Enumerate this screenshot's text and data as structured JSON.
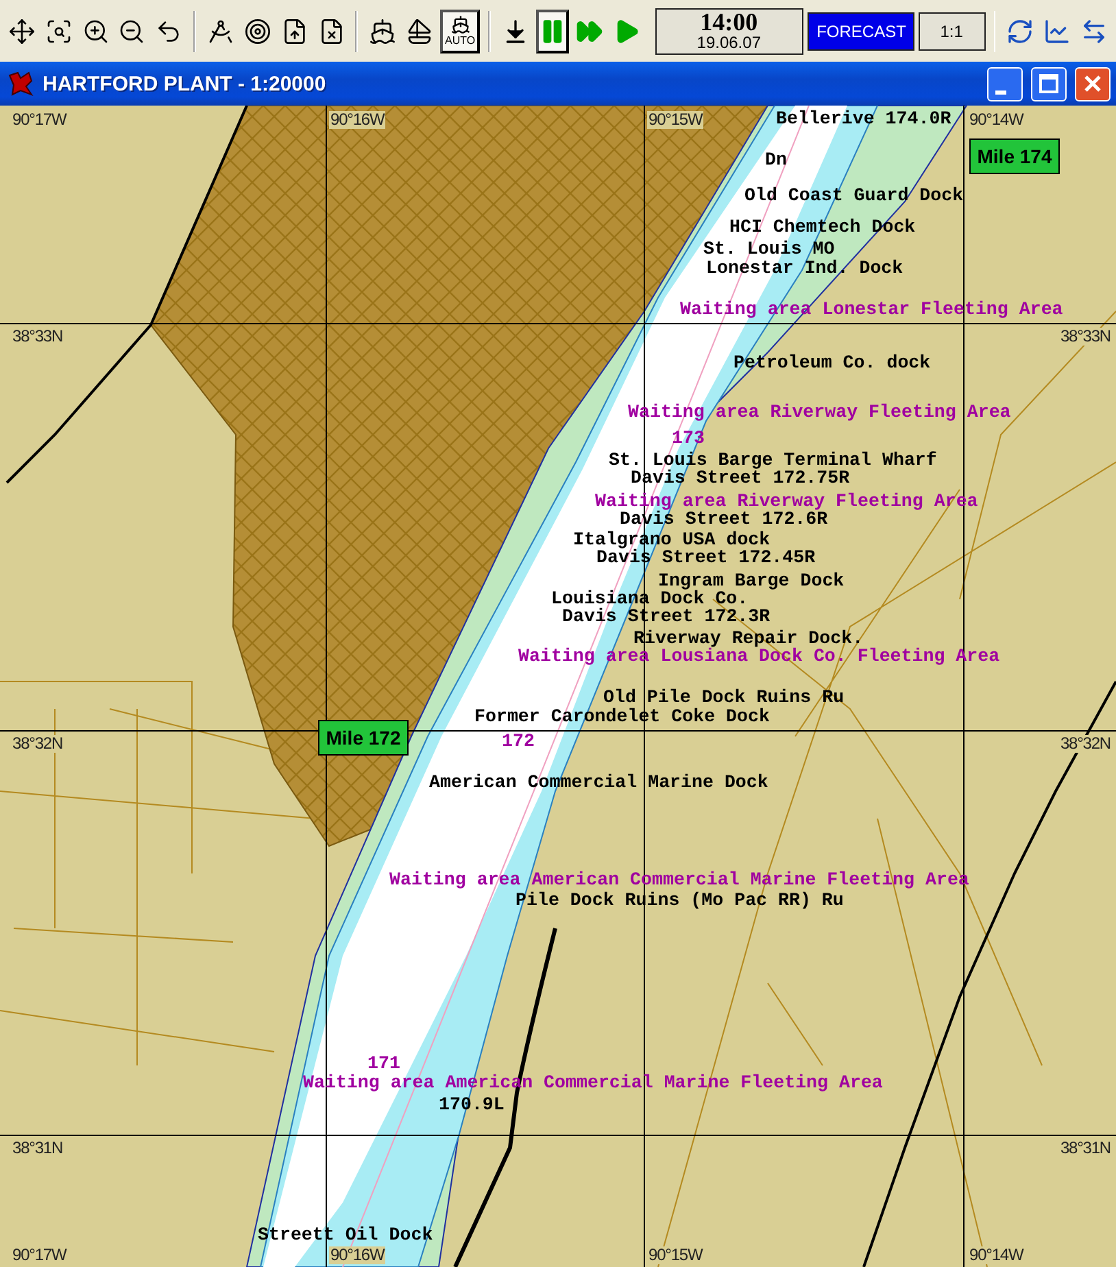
{
  "toolbar": {
    "tools": [
      {
        "pressed": false
      },
      {
        "pressed": false
      },
      {
        "pressed": false
      },
      {
        "pressed": false
      },
      {
        "pressed": false
      },
      {
        "pressed": false
      },
      {
        "pressed": false
      },
      {
        "pressed": false
      },
      {
        "pressed": false
      },
      {
        "pressed": false
      },
      {
        "pressed": false
      }
    ],
    "auto_button": {
      "label": "AUTO",
      "pressed": true
    },
    "playback": [
      {
        "pressed": false
      },
      {
        "pressed": true
      },
      {
        "pressed": false
      },
      {
        "pressed": false
      }
    ],
    "clock": {
      "time": "14:00",
      "date": "19.06.07"
    },
    "forecast_button": {
      "label": "FORECAST"
    },
    "scale": "1:1",
    "view_tools": [
      {
        "pressed": false
      },
      {
        "pressed": false
      },
      {
        "pressed": false
      }
    ]
  },
  "window": {
    "title": "HARTFORD PLANT - 1:20000"
  },
  "map": {
    "grid": {
      "top": [
        "90°17W",
        "90°16W",
        "90°15W",
        "90°14W"
      ],
      "bottom": [
        "90°17W",
        "90°16W",
        "90°15W",
        "90°14W"
      ],
      "left": [
        "38°33N",
        "38°32N",
        "38°31N"
      ],
      "right": [
        "38°33N",
        "38°32N",
        "38°31N"
      ]
    },
    "mile_markers": [
      "Mile 174",
      "Mile 172"
    ],
    "labels": [
      {
        "kind": "dock",
        "text": "Bellerive 174.0R"
      },
      {
        "kind": "dock",
        "text": "Dn"
      },
      {
        "kind": "dock",
        "text": "Old Coast Guard Dock"
      },
      {
        "kind": "dock",
        "text": "HCI Chemtech Dock"
      },
      {
        "kind": "dock",
        "text": "St. Louis MO"
      },
      {
        "kind": "dock",
        "text": "Lonestar Ind. Dock"
      },
      {
        "kind": "area",
        "text": "Waiting area Lonestar Fleeting Area"
      },
      {
        "kind": "dock",
        "text": "Petroleum Co. dock"
      },
      {
        "kind": "area",
        "text": "Waiting area Riverway Fleeting Area"
      },
      {
        "kind": "area",
        "text": "173"
      },
      {
        "kind": "dock",
        "text": "St. Louis Barge Terminal Wharf"
      },
      {
        "kind": "dock",
        "text": "Davis Street 172.75R"
      },
      {
        "kind": "area",
        "text": "Waiting area Riverway Fleeting Area"
      },
      {
        "kind": "dock",
        "text": "Davis Street 172.6R"
      },
      {
        "kind": "dock",
        "text": "Italgrano USA dock"
      },
      {
        "kind": "dock",
        "text": "Davis Street 172.45R"
      },
      {
        "kind": "dock",
        "text": "Ingram Barge Dock"
      },
      {
        "kind": "dock",
        "text": "Louisiana Dock Co."
      },
      {
        "kind": "dock",
        "text": "Davis Street 172.3R"
      },
      {
        "kind": "dock",
        "text": "Riverway Repair Dock."
      },
      {
        "kind": "area",
        "text": "Waiting area Lousiana Dock Co. Fleeting Area"
      },
      {
        "kind": "dock",
        "text": "Old Pile Dock Ruins Ru"
      },
      {
        "kind": "dock",
        "text": "Former Carondelet Coke Dock"
      },
      {
        "kind": "area",
        "text": "172"
      },
      {
        "kind": "dock",
        "text": "American Commercial Marine Dock"
      },
      {
        "kind": "area",
        "text": "Waiting area American Commercial Marine Fleeting Area"
      },
      {
        "kind": "dock",
        "text": "Pile Dock Ruins (Mo Pac RR) Ru"
      },
      {
        "kind": "area",
        "text": "171"
      },
      {
        "kind": "area",
        "text": "Waiting area American Commercial Marine Fleeting Area"
      },
      {
        "kind": "dock",
        "text": "170.9L"
      },
      {
        "kind": "dock",
        "text": "Streett Oil Dock"
      }
    ]
  }
}
